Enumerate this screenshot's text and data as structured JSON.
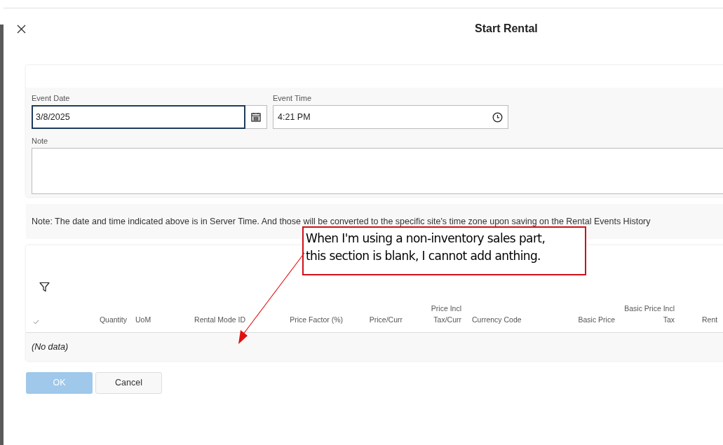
{
  "dialog": {
    "title": "Start Rental"
  },
  "form": {
    "event_date": {
      "label": "Event Date",
      "value": "3/8/2025",
      "focused": true
    },
    "event_time": {
      "label": "Event Time",
      "value": "4:21 PM",
      "focused": false
    },
    "note": {
      "label": "Note"
    }
  },
  "info_note": "Note: The date and time indicated above is in Server Time. And those will be converted to the specific site's time zone upon saving on the Rental Events History",
  "table": {
    "columns": [
      "Quantity",
      "UoM",
      "Rental Mode ID",
      "Price Factor (%)",
      "Price/Curr",
      "Price Incl Tax/Curr",
      "Currency Code",
      "Basic Price",
      "Basic Price Incl Tax",
      "Rent"
    ],
    "empty_text": "(No data)"
  },
  "buttons": [
    {
      "label": "OK",
      "disabled": true
    },
    {
      "label": "Cancel",
      "disabled": false
    }
  ],
  "annotation": {
    "lines": [
      "When I'm using a non-inventory sales part,",
      "this section is blank, I cannot add anthing."
    ]
  }
}
